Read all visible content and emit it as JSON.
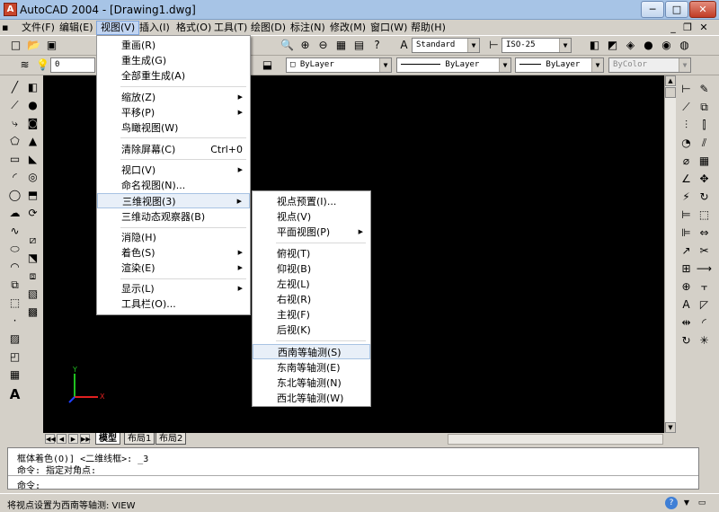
{
  "window": {
    "title": "AutoCAD 2004 - [Drawing1.dwg]",
    "app_icon": "autocad-app-icon",
    "controls": {
      "minimize": "─",
      "maximize": "□",
      "close": "✕"
    }
  },
  "menubar": {
    "items": [
      {
        "label": "文件(F)"
      },
      {
        "label": "编辑(E)"
      },
      {
        "label": "视图(V)"
      },
      {
        "label": "插入(I)"
      },
      {
        "label": "格式(O)"
      },
      {
        "label": "工具(T)"
      },
      {
        "label": "绘图(D)"
      },
      {
        "label": "标注(N)"
      },
      {
        "label": "修改(M)"
      },
      {
        "label": "窗口(W)"
      },
      {
        "label": "帮助(H)"
      }
    ],
    "inner_controls": {
      "minimize": "_",
      "restore": "❐",
      "close": "✕"
    }
  },
  "toolbar1": {
    "text_style": "Standard",
    "dim_style": "ISO-25"
  },
  "toolbar2": {
    "layer_value": "0",
    "color": "ByLayer",
    "linetype": "ByLayer",
    "lineweight": "ByLayer",
    "plot_style": "ByColor"
  },
  "view_menu": {
    "items": [
      {
        "label": "重画(R)"
      },
      {
        "label": "重生成(G)"
      },
      {
        "label": "全部重生成(A)"
      },
      {
        "label": "缩放(Z)",
        "submenu": "▶"
      },
      {
        "label": "平移(P)",
        "submenu": "▶"
      },
      {
        "label": "鸟瞰视图(W)"
      },
      {
        "label": "清除屏幕(C)",
        "shortcut": "Ctrl+0"
      },
      {
        "label": "视口(V)",
        "submenu": "▶"
      },
      {
        "label": "命名视图(N)..."
      },
      {
        "label": "三维视图(3)",
        "submenu": "▶"
      },
      {
        "label": "三维动态观察器(B)"
      },
      {
        "label": "消隐(H)"
      },
      {
        "label": "着色(S)",
        "submenu": "▶"
      },
      {
        "label": "渲染(E)",
        "submenu": "▶"
      },
      {
        "label": "显示(L)",
        "submenu": "▶"
      },
      {
        "label": "工具栏(O)..."
      }
    ]
  },
  "view3d_submenu": {
    "items": [
      {
        "label": "视点预置(I)..."
      },
      {
        "label": "视点(V)"
      },
      {
        "label": "平面视图(P)",
        "submenu": "▶"
      },
      {
        "label": "俯视(T)"
      },
      {
        "label": "仰视(B)"
      },
      {
        "label": "左视(L)"
      },
      {
        "label": "右视(R)"
      },
      {
        "label": "主视(F)"
      },
      {
        "label": "后视(K)"
      },
      {
        "label": "西南等轴测(S)"
      },
      {
        "label": "东南等轴测(E)"
      },
      {
        "label": "东北等轴测(N)"
      },
      {
        "label": "西北等轴测(W)"
      }
    ]
  },
  "ucs": {
    "x_label": "X",
    "y_label": "Y"
  },
  "layout_tabs": {
    "nav": [
      "◀◀",
      "◀",
      "▶",
      "▶▶"
    ],
    "tabs": [
      {
        "label": "模型"
      },
      {
        "label": "布局1"
      },
      {
        "label": "布局2"
      }
    ]
  },
  "command": {
    "lines": [
      "框体着色(O)] <二维线框>: _3",
      "命令: 指定对角点:",
      "命令:"
    ]
  },
  "status": {
    "text": "将视点设置为西南等轴测:   VIEW"
  },
  "colors": {
    "menu_active": "#c2d5f2",
    "highlight": "#e8eff8",
    "drawing_bg": "#000000",
    "ucs_x": "#e02020",
    "ucs_y": "#20c020",
    "ucs_z": "#2040ff"
  }
}
